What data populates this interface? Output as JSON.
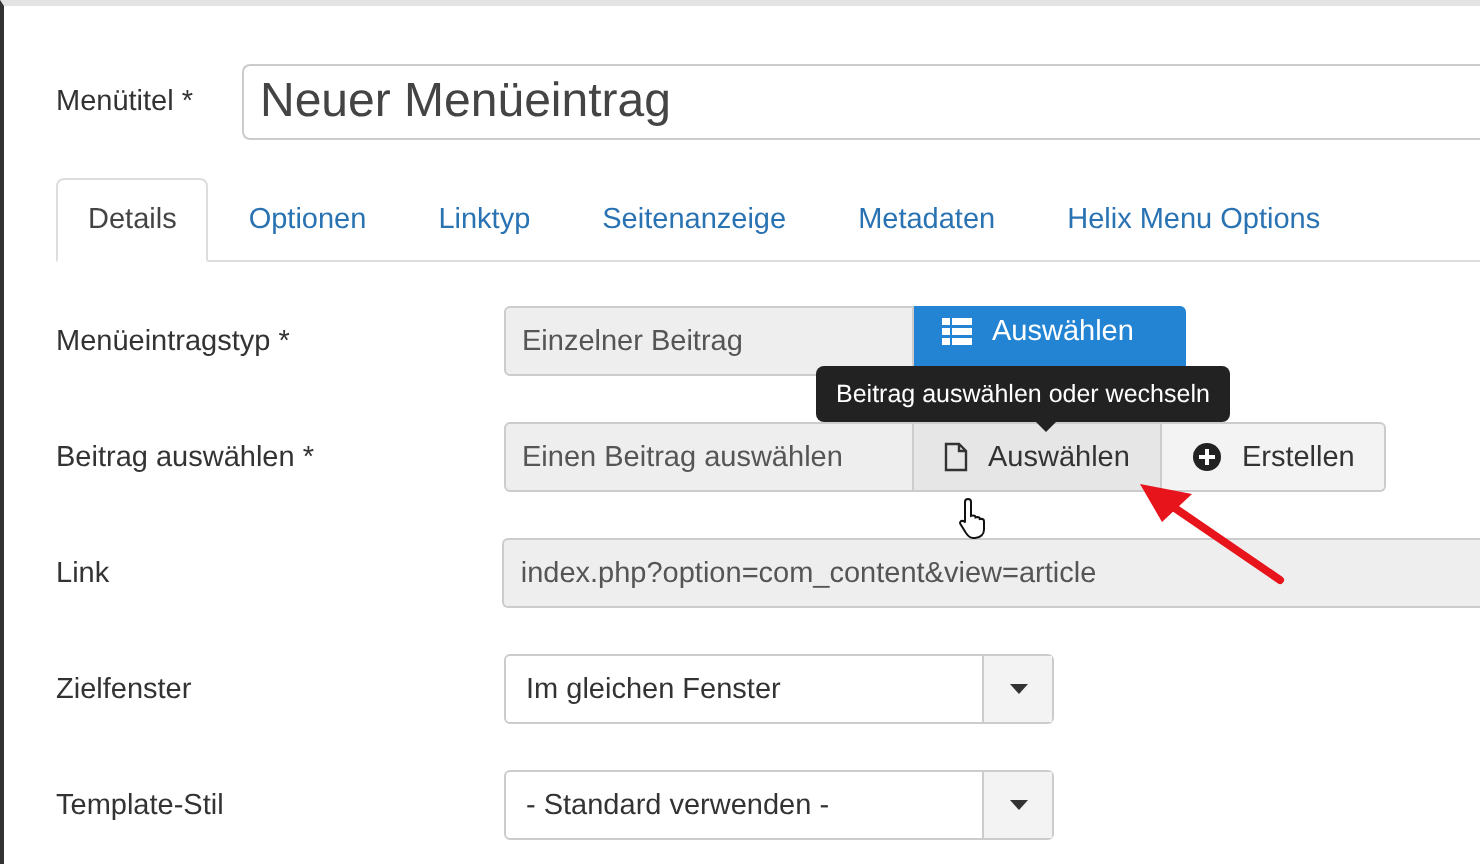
{
  "title_field": {
    "label": "Menütitel *",
    "value": "Neuer Menüeintrag"
  },
  "tabs": [
    {
      "label": "Details",
      "selected": true
    },
    {
      "label": "Optionen",
      "selected": false
    },
    {
      "label": "Linktyp",
      "selected": false
    },
    {
      "label": "Seitenanzeige",
      "selected": false
    },
    {
      "label": "Metadaten",
      "selected": false
    },
    {
      "label": "Helix Menu Options",
      "selected": false
    }
  ],
  "fields": [
    {
      "kind": "picker",
      "label": "Menüeintragstyp *",
      "value": "Einzelner Beitrag",
      "buttons": [
        {
          "label": "Auswählen",
          "primary": true
        }
      ]
    },
    {
      "kind": "picker",
      "label": "Beitrag auswählen *",
      "value": "Einen Beitrag auswählen",
      "buttons": [
        {
          "label": "Auswählen",
          "primary": false
        },
        {
          "label": "Erstellen",
          "primary": false
        }
      ]
    },
    {
      "kind": "readonly",
      "label": "Link",
      "value": "index.php?option=com_content&view=article"
    },
    {
      "kind": "select",
      "label": "Zielfenster",
      "value": "Im gleichen Fenster"
    },
    {
      "kind": "select",
      "label": "Template-Stil",
      "value": "- Standard verwenden -"
    }
  ],
  "tooltip": {
    "text": "Beitrag auswählen oder wechseln"
  }
}
